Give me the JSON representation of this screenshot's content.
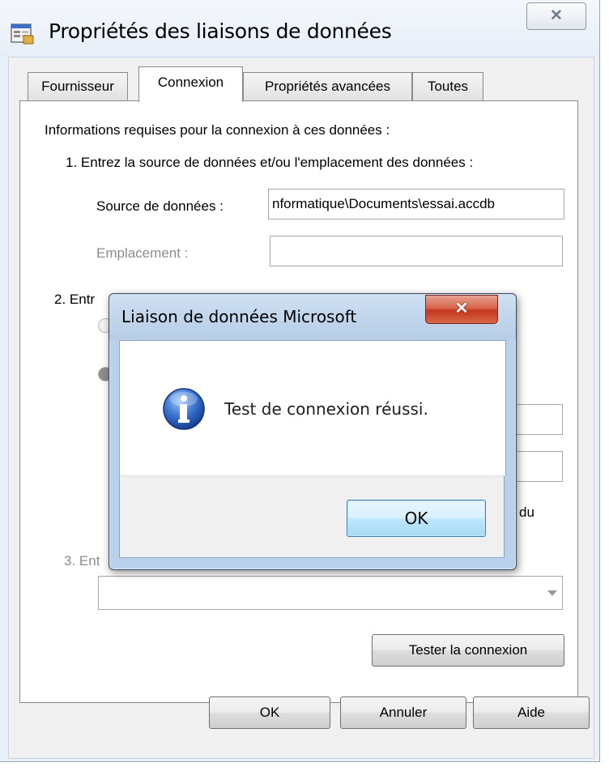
{
  "window": {
    "title": "Propriétés des liaisons de données",
    "close_glyph": "✕",
    "app_icon": "data-link-properties-icon"
  },
  "tabs": [
    {
      "label": "Fournisseur",
      "active": false
    },
    {
      "label": "Connexion",
      "active": true
    },
    {
      "label": "Propriétés avancées",
      "active": false
    },
    {
      "label": "Toutes",
      "active": false
    }
  ],
  "connection": {
    "intro": "Informations requises pour la connexion à ces données :",
    "step1": "1. Entrez la source de données et/ou l'emplacement des données :",
    "source_label": "Source de données :",
    "source_value": "nformatique\\Documents\\essai.accdb",
    "location_label": "Emplacement :",
    "location_value": "",
    "step2_partial": "2. Entr",
    "trailing_text": "du",
    "step3_partial": "3. Ent",
    "catalog_value": "",
    "test_button": "Tester la connexion"
  },
  "footer": {
    "ok": "OK",
    "cancel": "Annuler",
    "help": "Aide"
  },
  "message_box": {
    "title": "Liaison de données Microsoft",
    "close_glyph": "✕",
    "icon": "info-icon",
    "message": "Test de connexion réussi.",
    "ok": "OK"
  },
  "colors": {
    "msgbox_frame": "#b9d1ea",
    "close_red": "#c4391f",
    "ok_focus_blue": "#bee6fd",
    "info_icon_blue": "#2f63c0"
  }
}
